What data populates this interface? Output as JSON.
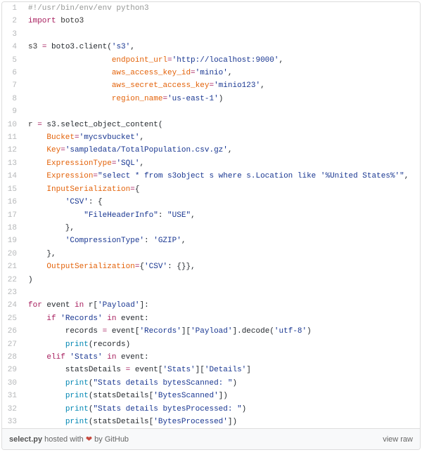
{
  "lines": [
    {
      "n": 1,
      "segs": [
        {
          "cls": "c-comment",
          "t": "#!/usr/bin/env/env python3"
        }
      ]
    },
    {
      "n": 2,
      "segs": [
        {
          "cls": "c-kw",
          "t": "import"
        },
        {
          "cls": "",
          "t": " "
        },
        {
          "cls": "c-var",
          "t": "boto3"
        }
      ]
    },
    {
      "n": 3,
      "segs": [
        {
          "cls": "",
          "t": ""
        }
      ]
    },
    {
      "n": 4,
      "segs": [
        {
          "cls": "c-var",
          "t": "s3"
        },
        {
          "cls": "",
          "t": " "
        },
        {
          "cls": "c-kw",
          "t": "="
        },
        {
          "cls": "",
          "t": " boto3.client("
        },
        {
          "cls": "c-str",
          "t": "'s3'"
        },
        {
          "cls": "",
          "t": ","
        }
      ]
    },
    {
      "n": 5,
      "segs": [
        {
          "cls": "",
          "t": "                  "
        },
        {
          "cls": "c-entity",
          "t": "endpoint_url"
        },
        {
          "cls": "c-kw",
          "t": "="
        },
        {
          "cls": "c-str",
          "t": "'http://localhost:9000'"
        },
        {
          "cls": "",
          "t": ","
        }
      ]
    },
    {
      "n": 6,
      "segs": [
        {
          "cls": "",
          "t": "                  "
        },
        {
          "cls": "c-entity",
          "t": "aws_access_key_id"
        },
        {
          "cls": "c-kw",
          "t": "="
        },
        {
          "cls": "c-str",
          "t": "'minio'"
        },
        {
          "cls": "",
          "t": ","
        }
      ]
    },
    {
      "n": 7,
      "segs": [
        {
          "cls": "",
          "t": "                  "
        },
        {
          "cls": "c-entity",
          "t": "aws_secret_access_key"
        },
        {
          "cls": "c-kw",
          "t": "="
        },
        {
          "cls": "c-str",
          "t": "'minio123'"
        },
        {
          "cls": "",
          "t": ","
        }
      ]
    },
    {
      "n": 8,
      "segs": [
        {
          "cls": "",
          "t": "                  "
        },
        {
          "cls": "c-entity",
          "t": "region_name"
        },
        {
          "cls": "c-kw",
          "t": "="
        },
        {
          "cls": "c-str",
          "t": "'us-east-1'"
        },
        {
          "cls": "",
          "t": ")"
        }
      ]
    },
    {
      "n": 9,
      "segs": [
        {
          "cls": "",
          "t": ""
        }
      ]
    },
    {
      "n": 10,
      "segs": [
        {
          "cls": "c-var",
          "t": "r"
        },
        {
          "cls": "",
          "t": " "
        },
        {
          "cls": "c-kw",
          "t": "="
        },
        {
          "cls": "",
          "t": " s3.select_object_content("
        }
      ]
    },
    {
      "n": 11,
      "segs": [
        {
          "cls": "",
          "t": "    "
        },
        {
          "cls": "c-entity",
          "t": "Bucket"
        },
        {
          "cls": "c-kw",
          "t": "="
        },
        {
          "cls": "c-str",
          "t": "'mycsvbucket'"
        },
        {
          "cls": "",
          "t": ","
        }
      ]
    },
    {
      "n": 12,
      "segs": [
        {
          "cls": "",
          "t": "    "
        },
        {
          "cls": "c-entity",
          "t": "Key"
        },
        {
          "cls": "c-kw",
          "t": "="
        },
        {
          "cls": "c-str",
          "t": "'sampledata/TotalPopulation.csv.gz'"
        },
        {
          "cls": "",
          "t": ","
        }
      ]
    },
    {
      "n": 13,
      "segs": [
        {
          "cls": "",
          "t": "    "
        },
        {
          "cls": "c-entity",
          "t": "ExpressionType"
        },
        {
          "cls": "c-kw",
          "t": "="
        },
        {
          "cls": "c-str",
          "t": "'SQL'"
        },
        {
          "cls": "",
          "t": ","
        }
      ]
    },
    {
      "n": 14,
      "segs": [
        {
          "cls": "",
          "t": "    "
        },
        {
          "cls": "c-entity",
          "t": "Expression"
        },
        {
          "cls": "c-kw",
          "t": "="
        },
        {
          "cls": "c-str",
          "t": "\"select * from s3object s where s.Location like '%United States%'\""
        },
        {
          "cls": "",
          "t": ","
        }
      ]
    },
    {
      "n": 15,
      "segs": [
        {
          "cls": "",
          "t": "    "
        },
        {
          "cls": "c-entity",
          "t": "InputSerialization"
        },
        {
          "cls": "c-kw",
          "t": "="
        },
        {
          "cls": "",
          "t": "{"
        }
      ]
    },
    {
      "n": 16,
      "segs": [
        {
          "cls": "",
          "t": "        "
        },
        {
          "cls": "c-str",
          "t": "'CSV'"
        },
        {
          "cls": "",
          "t": ": {"
        }
      ]
    },
    {
      "n": 17,
      "segs": [
        {
          "cls": "",
          "t": "            "
        },
        {
          "cls": "c-str",
          "t": "\"FileHeaderInfo\""
        },
        {
          "cls": "",
          "t": ": "
        },
        {
          "cls": "c-str",
          "t": "\"USE\""
        },
        {
          "cls": "",
          "t": ","
        }
      ]
    },
    {
      "n": 18,
      "segs": [
        {
          "cls": "",
          "t": "        },"
        }
      ]
    },
    {
      "n": 19,
      "segs": [
        {
          "cls": "",
          "t": "        "
        },
        {
          "cls": "c-str",
          "t": "'CompressionType'"
        },
        {
          "cls": "",
          "t": ": "
        },
        {
          "cls": "c-str",
          "t": "'GZIP'"
        },
        {
          "cls": "",
          "t": ","
        }
      ]
    },
    {
      "n": 20,
      "segs": [
        {
          "cls": "",
          "t": "    },"
        }
      ]
    },
    {
      "n": 21,
      "segs": [
        {
          "cls": "",
          "t": "    "
        },
        {
          "cls": "c-entity",
          "t": "OutputSerialization"
        },
        {
          "cls": "c-kw",
          "t": "="
        },
        {
          "cls": "",
          "t": "{"
        },
        {
          "cls": "c-str",
          "t": "'CSV'"
        },
        {
          "cls": "",
          "t": ": {}},"
        }
      ]
    },
    {
      "n": 22,
      "segs": [
        {
          "cls": "",
          "t": ")"
        }
      ]
    },
    {
      "n": 23,
      "segs": [
        {
          "cls": "",
          "t": ""
        }
      ]
    },
    {
      "n": 24,
      "segs": [
        {
          "cls": "c-kw",
          "t": "for"
        },
        {
          "cls": "",
          "t": " event "
        },
        {
          "cls": "c-kw",
          "t": "in"
        },
        {
          "cls": "",
          "t": " r["
        },
        {
          "cls": "c-str",
          "t": "'Payload'"
        },
        {
          "cls": "",
          "t": "]:"
        }
      ]
    },
    {
      "n": 25,
      "segs": [
        {
          "cls": "",
          "t": "    "
        },
        {
          "cls": "c-kw",
          "t": "if"
        },
        {
          "cls": "",
          "t": " "
        },
        {
          "cls": "c-str",
          "t": "'Records'"
        },
        {
          "cls": "",
          "t": " "
        },
        {
          "cls": "c-kw",
          "t": "in"
        },
        {
          "cls": "",
          "t": " event:"
        }
      ]
    },
    {
      "n": 26,
      "segs": [
        {
          "cls": "",
          "t": "        records "
        },
        {
          "cls": "c-kw",
          "t": "="
        },
        {
          "cls": "",
          "t": " event["
        },
        {
          "cls": "c-str",
          "t": "'Records'"
        },
        {
          "cls": "",
          "t": "]["
        },
        {
          "cls": "c-str",
          "t": "'Payload'"
        },
        {
          "cls": "",
          "t": "].decode("
        },
        {
          "cls": "c-str",
          "t": "'utf-8'"
        },
        {
          "cls": "",
          "t": ")"
        }
      ]
    },
    {
      "n": 27,
      "segs": [
        {
          "cls": "",
          "t": "        "
        },
        {
          "cls": "c-builtin",
          "t": "print"
        },
        {
          "cls": "",
          "t": "(records)"
        }
      ]
    },
    {
      "n": 28,
      "segs": [
        {
          "cls": "",
          "t": "    "
        },
        {
          "cls": "c-kw",
          "t": "elif"
        },
        {
          "cls": "",
          "t": " "
        },
        {
          "cls": "c-str",
          "t": "'Stats'"
        },
        {
          "cls": "",
          "t": " "
        },
        {
          "cls": "c-kw",
          "t": "in"
        },
        {
          "cls": "",
          "t": " event:"
        }
      ]
    },
    {
      "n": 29,
      "segs": [
        {
          "cls": "",
          "t": "        statsDetails "
        },
        {
          "cls": "c-kw",
          "t": "="
        },
        {
          "cls": "",
          "t": " event["
        },
        {
          "cls": "c-str",
          "t": "'Stats'"
        },
        {
          "cls": "",
          "t": "]["
        },
        {
          "cls": "c-str",
          "t": "'Details'"
        },
        {
          "cls": "",
          "t": "]"
        }
      ]
    },
    {
      "n": 30,
      "segs": [
        {
          "cls": "",
          "t": "        "
        },
        {
          "cls": "c-builtin",
          "t": "print"
        },
        {
          "cls": "",
          "t": "("
        },
        {
          "cls": "c-str",
          "t": "\"Stats details bytesScanned: \""
        },
        {
          "cls": "",
          "t": ")"
        }
      ]
    },
    {
      "n": 31,
      "segs": [
        {
          "cls": "",
          "t": "        "
        },
        {
          "cls": "c-builtin",
          "t": "print"
        },
        {
          "cls": "",
          "t": "(statsDetails["
        },
        {
          "cls": "c-str",
          "t": "'BytesScanned'"
        },
        {
          "cls": "",
          "t": "])"
        }
      ]
    },
    {
      "n": 32,
      "segs": [
        {
          "cls": "",
          "t": "        "
        },
        {
          "cls": "c-builtin",
          "t": "print"
        },
        {
          "cls": "",
          "t": "("
        },
        {
          "cls": "c-str",
          "t": "\"Stats details bytesProcessed: \""
        },
        {
          "cls": "",
          "t": ")"
        }
      ]
    },
    {
      "n": 33,
      "segs": [
        {
          "cls": "",
          "t": "        "
        },
        {
          "cls": "c-builtin",
          "t": "print"
        },
        {
          "cls": "",
          "t": "(statsDetails["
        },
        {
          "cls": "c-str",
          "t": "'BytesProcessed'"
        },
        {
          "cls": "",
          "t": "])"
        }
      ]
    }
  ],
  "footer": {
    "filename": "select.py",
    "hosted_text": " hosted with ",
    "heart": "❤",
    "by_text": " by ",
    "host": "GitHub",
    "view_raw": "view raw"
  }
}
